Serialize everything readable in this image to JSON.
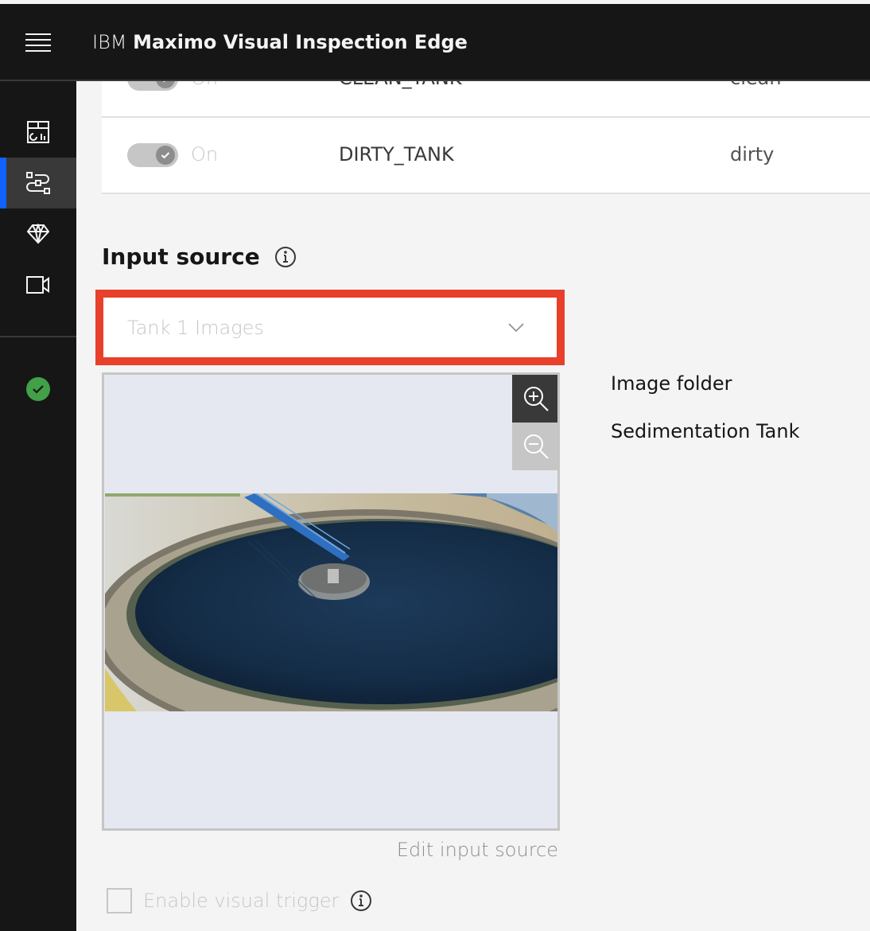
{
  "header": {
    "menu_icon": "hamburger-menu-icon",
    "brand": "IBM",
    "product": "Maximo Visual Inspection Edge"
  },
  "sidebar": {
    "items": [
      {
        "icon": "dashboard-icon",
        "label": "Dashboard",
        "active": false
      },
      {
        "icon": "flow-icon",
        "label": "Inspections",
        "active": true
      },
      {
        "icon": "diamond-model-icon",
        "label": "Models",
        "active": false
      },
      {
        "icon": "video-camera-icon",
        "label": "Input sources",
        "active": false
      }
    ],
    "status_icon": "checkmark-filled-icon",
    "colors": {
      "active_indicator": "#0f62fe",
      "status_ok": "#42a047"
    }
  },
  "rules_table": {
    "rows": [
      {
        "toggle_state": "On",
        "enabled": true,
        "class_name": "CLEAN_TANK",
        "label": "clean"
      },
      {
        "toggle_state": "On",
        "enabled": true,
        "class_name": "DIRTY_TANK",
        "label": "dirty"
      }
    ]
  },
  "input_source": {
    "title": "Input source",
    "info_icon": "information-icon",
    "dropdown": {
      "selected": "Tank 1 Images",
      "highlight_color": "#e8402a"
    },
    "preview": {
      "image_description": "Circular sedimentation tank with blue walkway bridge",
      "zoom_in_label": "Zoom in",
      "zoom_out_label": "Zoom out"
    },
    "source_type": "Image folder",
    "source_name": "Sedimentation Tank",
    "edit_link": "Edit input source"
  },
  "visual_trigger": {
    "label": "Enable visual trigger",
    "checked": false
  }
}
